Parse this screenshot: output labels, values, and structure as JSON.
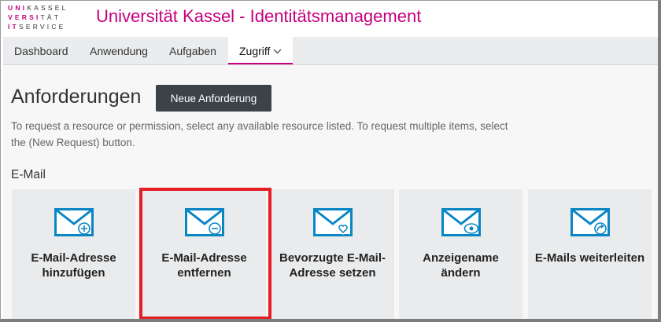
{
  "header": {
    "logo_rows": [
      [
        "UNI",
        "KASSEL"
      ],
      [
        "VERSI",
        "TÄT"
      ],
      [
        "",
        "SERVICE"
      ]
    ],
    "logo_it_letters": [
      "I",
      "T"
    ],
    "title": "Universität Kassel - Identitätsmanagement",
    "accent_color": "#c6007e"
  },
  "nav": {
    "items": [
      {
        "label": "Dashboard"
      },
      {
        "label": "Anwendung"
      },
      {
        "label": "Aufgaben"
      },
      {
        "label": "Zugriff",
        "active": true,
        "icon": "chevron-down-icon"
      }
    ]
  },
  "main": {
    "title": "Anforderungen",
    "new_request_label": "Neue Anforderung",
    "description": "To request a resource or permission, select any available resource listed. To request multiple items, select the (New Request) button.",
    "section_title": "E-Mail",
    "tiles": [
      {
        "label": "E-Mail-Adresse hinzufügen",
        "icon": "mail-add-icon"
      },
      {
        "label": "E-Mail-Adresse entfernen",
        "icon": "mail-remove-icon",
        "highlighted": true
      },
      {
        "label": "Bevorzugte E-Mail-Adresse setzen",
        "icon": "mail-favorite-icon"
      },
      {
        "label": "Anzeigename ändern",
        "icon": "mail-view-icon"
      },
      {
        "label": "E-Mails weiterleiten",
        "icon": "mail-forward-icon"
      }
    ],
    "icon_color": "#0a86c4",
    "highlight_color": "#e31e24"
  }
}
